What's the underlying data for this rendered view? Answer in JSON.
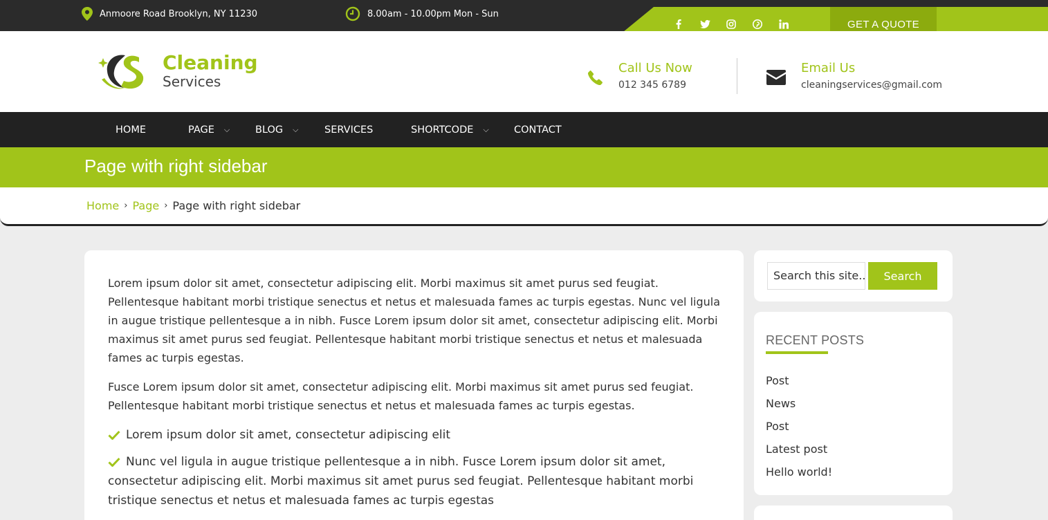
{
  "topbar": {
    "address": "Anmoore Road Brooklyn, NY 11230",
    "hours": "8.00am - 10.00pm Mon - Sun",
    "social": [
      "facebook-icon",
      "twitter-icon",
      "instagram-icon",
      "pinterest-icon",
      "linkedin-icon"
    ],
    "quote_label": "GET A QUOTE"
  },
  "logo": {
    "title": "Cleaning",
    "subtitle": "Services"
  },
  "contact": {
    "call_title": "Call Us Now",
    "call_value": "012 345 6789",
    "email_title": "Email Us",
    "email_value": "cleaningservices@gmail.com"
  },
  "nav": [
    {
      "label": "HOME"
    },
    {
      "label": "PAGE"
    },
    {
      "label": "BLOG"
    },
    {
      "label": "SERVICES"
    },
    {
      "label": "SHORTCODE"
    },
    {
      "label": "CONTACT"
    }
  ],
  "page_title": "Page with right sidebar",
  "breadcrumb": {
    "home": "Home",
    "page": "Page",
    "current": "Page with right sidebar"
  },
  "content": {
    "p1": "Lorem ipsum dolor sit amet, consectetur adipiscing elit. Morbi maximus sit amet purus sed feugiat. Pellentesque habitant morbi tristique senectus et netus et malesuada fames ac turpis egestas. Nunc vel ligula in augue tristique pellentesque a in nibh. Fusce Lorem ipsum dolor sit amet, consectetur adipiscing elit. Morbi maximus sit amet purus sed feugiat. Pellentesque habitant morbi tristique senectus et netus et malesuada fames ac turpis egestas.",
    "p2": "Fusce Lorem ipsum dolor sit amet, consectetur adipiscing elit. Morbi maximus sit amet purus sed feugiat. Pellentesque habitant morbi tristique senectus et netus et malesuada fames ac turpis egestas.",
    "list": [
      "Lorem ipsum dolor sit amet, consectetur adipiscing elit",
      "Nunc vel ligula in augue tristique pellentesque a in nibh. Fusce Lorem ipsum dolor sit amet, consectetur adipiscing elit. Morbi maximus sit amet purus sed feugiat. Pellentesque habitant morbi tristique senectus et netus et malesuada fames ac turpis egestas"
    ]
  },
  "sidebar": {
    "search_placeholder": "Search this site...",
    "search_button": "Search",
    "recent_title": "RECENT POSTS",
    "recent": [
      "Post",
      "News",
      "Post",
      "Latest post",
      "Hello world!"
    ]
  },
  "colors": {
    "accent": "#a1c41a",
    "dark": "#222222",
    "topbar": "#2b2b2b",
    "quote_button": "#8cab0e"
  }
}
